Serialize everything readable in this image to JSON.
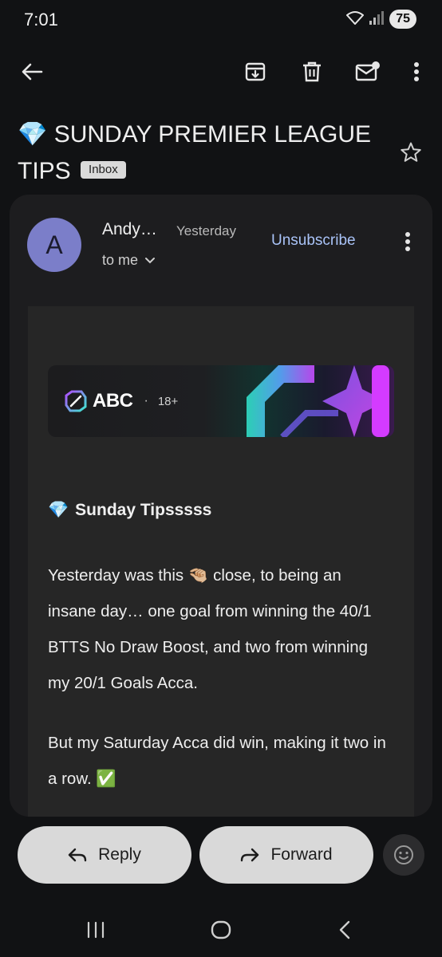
{
  "status_bar": {
    "time": "7:01",
    "battery": "75"
  },
  "toolbar": {
    "back_icon": "arrow-left",
    "archive_icon": "archive",
    "delete_icon": "trash",
    "mark_unread_icon": "mail-unread",
    "more_icon": "more-vertical"
  },
  "subject": {
    "emoji": "💎",
    "text": "SUNDAY PREMIER LEAGUE TIPS",
    "label": "Inbox"
  },
  "message": {
    "avatar_initial": "A",
    "sender": "Andy…",
    "time": "Yesterday",
    "recipient": "to me",
    "unsubscribe": "Unsubscribe"
  },
  "banner": {
    "brand": "ABC",
    "separator": "·",
    "age": "18+"
  },
  "body": {
    "heading_emoji": "💎",
    "heading": "Sunday Tipsssss",
    "paragraph_1": "Yesterday was this 🤏🏼 close, to being an insane day… one goal from winning the 40/1 BTTS No Draw Boost, and two from winning my 20/1 Goals Acca.",
    "paragraph_2": "But my Saturday Acca did win, making it two in a row. ✅"
  },
  "actions": {
    "reply": "Reply",
    "forward": "Forward"
  },
  "colors": {
    "background": "#111214",
    "card": "#1d1d1f",
    "avatar": "#7b7ec9",
    "link": "#a9c3f7",
    "pill": "#d9d9d9"
  }
}
